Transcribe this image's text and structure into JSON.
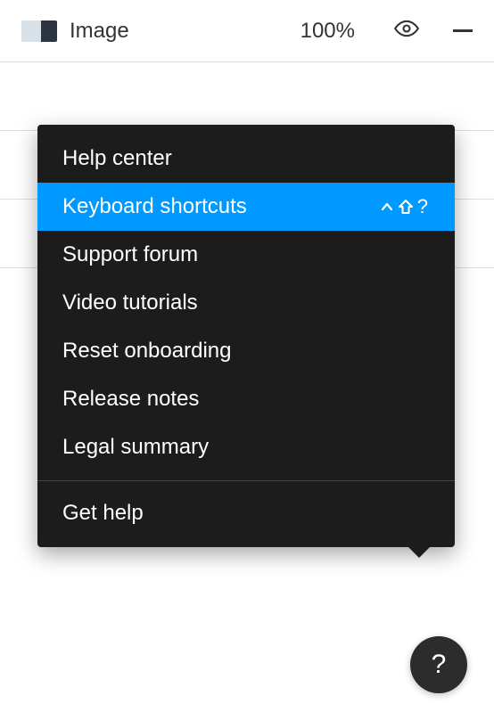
{
  "layer": {
    "name": "Image",
    "opacity": "100%"
  },
  "menu": {
    "items": [
      {
        "label": "Help center",
        "shortcut": "",
        "highlighted": false
      },
      {
        "label": "Keyboard shortcuts",
        "shortcut": "⌃⇧?",
        "highlighted": true
      },
      {
        "label": "Support forum",
        "shortcut": "",
        "highlighted": false
      },
      {
        "label": "Video tutorials",
        "shortcut": "",
        "highlighted": false
      },
      {
        "label": "Reset onboarding",
        "shortcut": "",
        "highlighted": false
      },
      {
        "label": "Release notes",
        "shortcut": "",
        "highlighted": false
      },
      {
        "label": "Legal summary",
        "shortcut": "",
        "highlighted": false
      }
    ],
    "footer": {
      "label": "Get help"
    }
  },
  "help_button": {
    "label": "?"
  }
}
